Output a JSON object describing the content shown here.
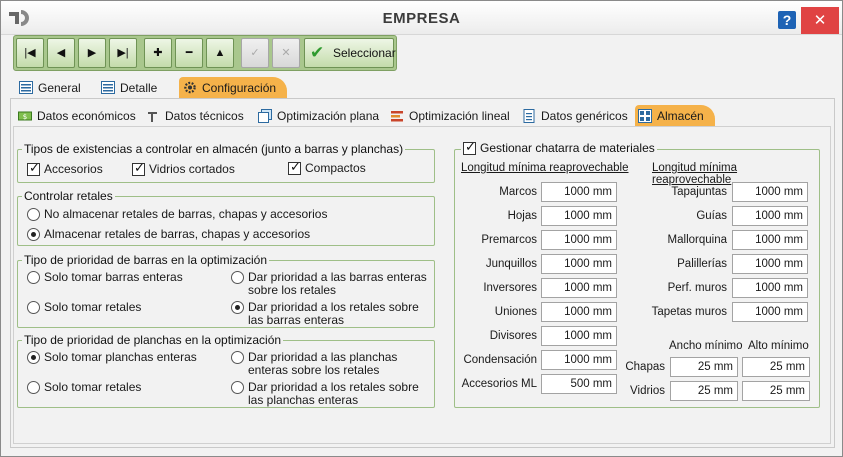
{
  "window": {
    "title": "EMPRESA",
    "help": "?",
    "close": "✕"
  },
  "toolbar": {
    "first": "|◀",
    "prev": "◀",
    "next": "▶",
    "last": "▶|",
    "add": "✚",
    "remove": "━",
    "up": "▲",
    "select_label": "Seleccionar"
  },
  "tabs": {
    "general": "General",
    "detalle": "Detalle",
    "configuracion": "Configuración"
  },
  "subtabs": {
    "economicos": "Datos económicos",
    "tecnicos": "Datos técnicos",
    "optim_plana": "Optimización plana",
    "optim_lineal": "Optimización lineal",
    "genericos": "Datos genéricos",
    "almacen": "Almacén"
  },
  "stock": {
    "legend": "Tipos de existencias a controlar en almacén (junto a barras y planchas)",
    "accesorios": "Accesorios",
    "vidrios": "Vidrios cortados",
    "compactos": "Compactos"
  },
  "retales": {
    "legend": "Controlar retales",
    "opt1": "No almacenar retales de barras, chapas y accesorios",
    "opt2": "Almacenar retales de barras, chapas y accesorios"
  },
  "barras": {
    "legend": "Tipo de prioridad de barras en la optimización",
    "a": "Solo tomar barras enteras",
    "b": "Solo tomar retales",
    "c": "Dar prioridad a las barras enteras sobre los retales",
    "d": "Dar prioridad a los retales sobre las barras enteras"
  },
  "planchas": {
    "legend": "Tipo de prioridad de planchas en la optimización",
    "a": "Solo tomar planchas enteras",
    "b": "Solo tomar retales",
    "c": "Dar prioridad a las planchas  enteras sobre los retales",
    "d": "Dar prioridad a los retales sobre las planchas enteras"
  },
  "chatarra": {
    "legend": "Gestionar chatarra de materiales",
    "col_header": "Longitud mínima reaprovechable",
    "left": [
      {
        "label": "Marcos",
        "value": "1000 mm"
      },
      {
        "label": "Hojas",
        "value": "1000 mm"
      },
      {
        "label": "Premarcos",
        "value": "1000 mm"
      },
      {
        "label": "Junquillos",
        "value": "1000 mm"
      },
      {
        "label": "Inversores",
        "value": "1000 mm"
      },
      {
        "label": "Uniones",
        "value": "1000 mm"
      },
      {
        "label": "Divisores",
        "value": "1000 mm"
      },
      {
        "label": "Condensación",
        "value": "1000 mm"
      },
      {
        "label": "Accesorios ML",
        "value": "500 mm"
      }
    ],
    "right": [
      {
        "label": "Tapajuntas",
        "value": "1000 mm"
      },
      {
        "label": "Guías",
        "value": "1000 mm"
      },
      {
        "label": "Mallorquina",
        "value": "1000 mm"
      },
      {
        "label": "Palillerías",
        "value": "1000 mm"
      },
      {
        "label": "Perf. muros",
        "value": "1000 mm"
      },
      {
        "label": "Tapetas muros",
        "value": "1000 mm"
      }
    ],
    "ancho": "Ancho mínimo",
    "alto": "Alto mínimo",
    "chapas": {
      "label": "Chapas",
      "ancho": "25 mm",
      "alto": "25 mm"
    },
    "vidrios": {
      "label": "Vidrios",
      "ancho": "25 mm",
      "alto": "25 mm"
    }
  }
}
